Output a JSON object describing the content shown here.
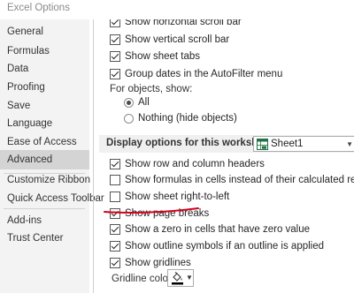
{
  "window": {
    "title": "Excel Options"
  },
  "sidebar": {
    "items": [
      {
        "label": "General",
        "active": false
      },
      {
        "label": "Formulas",
        "active": false
      },
      {
        "label": "Data",
        "active": false
      },
      {
        "label": "Proofing",
        "active": false
      },
      {
        "label": "Save",
        "active": false
      },
      {
        "label": "Language",
        "active": false
      },
      {
        "label": "Ease of Access",
        "active": false
      },
      {
        "label": "Advanced",
        "active": true
      },
      {
        "label": "Customize Ribbon",
        "active": false
      },
      {
        "label": "Quick Access Toolbar",
        "active": false
      },
      {
        "label": "Add-ins",
        "active": false
      },
      {
        "label": "Trust Center",
        "active": false
      }
    ]
  },
  "workbook_options": [
    {
      "label": "Show horizontal scroll bar",
      "checked": true
    },
    {
      "label": "Show vertical scroll bar",
      "checked": true
    },
    {
      "label": "Show sheet tabs",
      "checked": true
    },
    {
      "label": "Group dates in the AutoFilter menu",
      "checked": true
    }
  ],
  "objects": {
    "heading": "For objects, show:",
    "options": [
      {
        "label": "All",
        "selected": true
      },
      {
        "label": "Nothing (hide objects)",
        "selected": false
      }
    ]
  },
  "worksheet_section": {
    "title": "Display options for this worksheet:",
    "selected_sheet": "Sheet1"
  },
  "worksheet_options": [
    {
      "label": "Show row and column headers",
      "checked": true
    },
    {
      "label": "Show formulas in cells instead of their calculated results",
      "checked": false
    },
    {
      "label": "Show sheet right-to-left",
      "checked": false
    },
    {
      "label": "Show page breaks",
      "checked": true
    },
    {
      "label": "Show a zero in cells that have zero value",
      "checked": true
    },
    {
      "label": "Show outline symbols if an outline is applied",
      "checked": true
    },
    {
      "label": "Show gridlines",
      "checked": true
    }
  ],
  "gridline": {
    "label": "Gridline color"
  },
  "colors": {
    "annotation": "#d0021b",
    "active_nav": "#d4d4d4",
    "sidebar_bg": "#f3f3f3"
  }
}
